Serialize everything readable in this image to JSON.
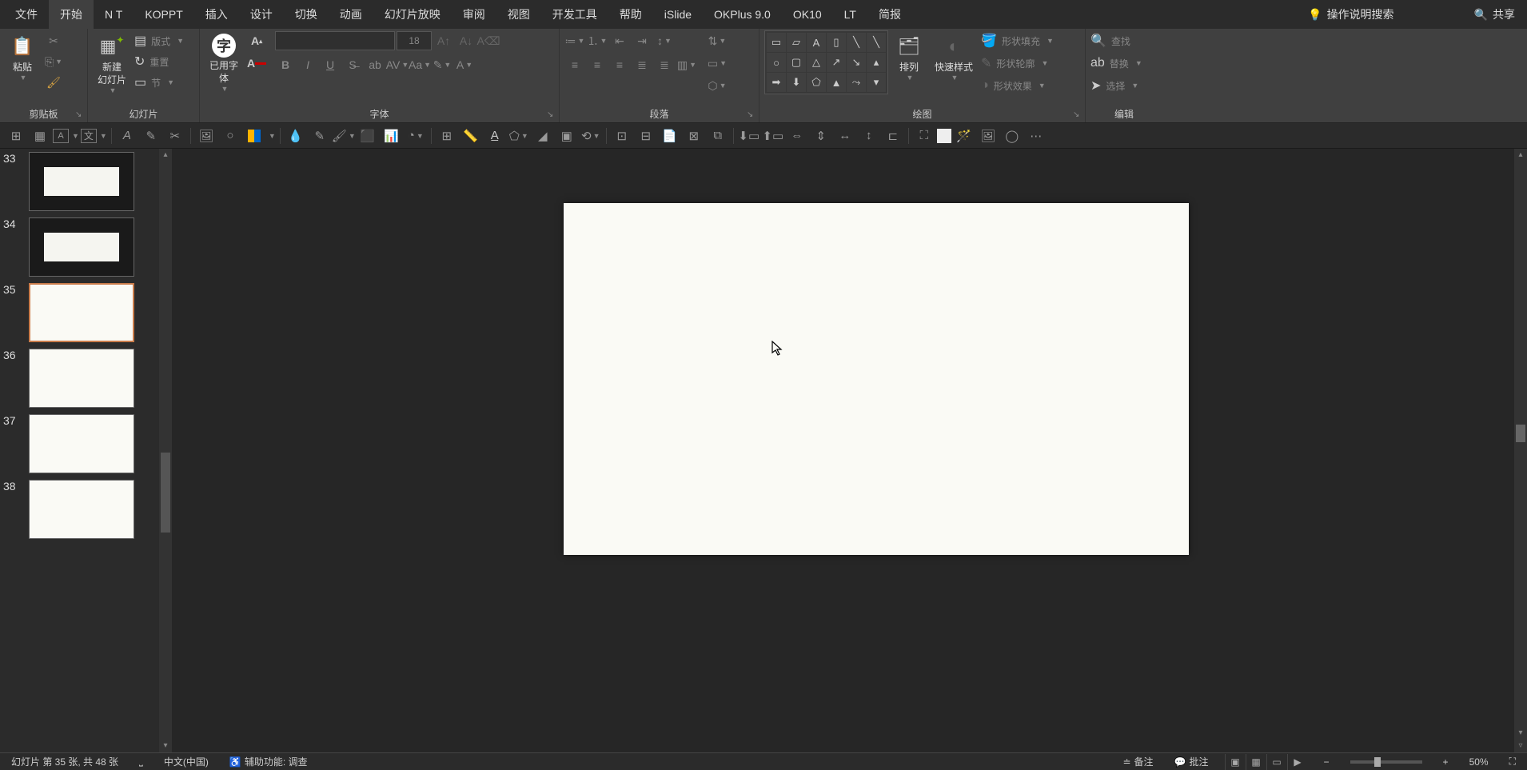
{
  "menubar": {
    "tabs": [
      "文件",
      "开始",
      "N T",
      "KOPPT",
      "插入",
      "设计",
      "切换",
      "动画",
      "幻灯片放映",
      "审阅",
      "视图",
      "开发工具",
      "帮助",
      "iSlide",
      "OKPlus 9.0",
      "OK10",
      "LT",
      "简报"
    ],
    "active_index": 1,
    "search_hint": "操作说明搜索",
    "share": "共享"
  },
  "ribbon": {
    "clipboard": {
      "paste": "粘贴",
      "label": "剪贴板"
    },
    "slides": {
      "new_slide": "新建\n幻灯片",
      "layout": "版式",
      "reset": "重置",
      "section": "节",
      "label": "幻灯片"
    },
    "font_group": {
      "used_font": "已用字\n体",
      "size": "18",
      "label": "字体"
    },
    "paragraph": {
      "label": "段落"
    },
    "drawing": {
      "arrange": "排列",
      "quick_styles": "快速样式",
      "fill": "形状填充",
      "outline": "形状轮廓",
      "effects": "形状效果",
      "label": "绘图"
    },
    "editing": {
      "find": "查找",
      "replace": "替换",
      "select": "选择",
      "label": "编辑"
    }
  },
  "thumbnails": [
    {
      "num": "33",
      "dark": true
    },
    {
      "num": "34",
      "dark": true
    },
    {
      "num": "35",
      "dark": false,
      "selected": true
    },
    {
      "num": "36",
      "dark": false
    },
    {
      "num": "37",
      "dark": false
    },
    {
      "num": "38",
      "dark": false
    }
  ],
  "statusbar": {
    "slide_info": "幻灯片 第 35 张, 共 48 张",
    "language": "中文(中国)",
    "accessibility": "辅助功能: 调查",
    "notes": "备注",
    "comments": "批注",
    "zoom": "50%"
  }
}
